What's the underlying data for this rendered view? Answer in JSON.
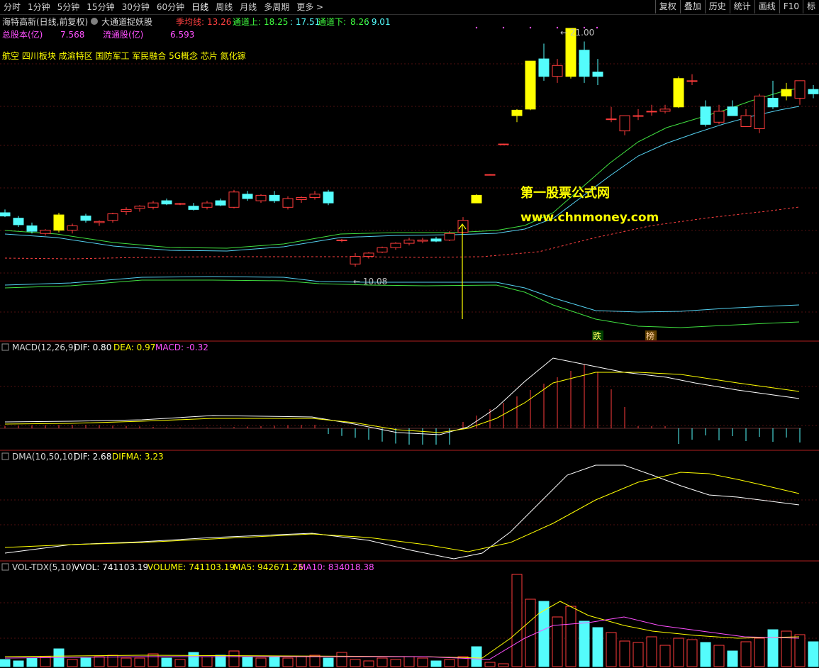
{
  "toolbar": {
    "tabs": [
      "分时",
      "1分钟",
      "5分钟",
      "15分钟",
      "30分钟",
      "60分钟",
      "日线",
      "周线",
      "月线",
      "多周期",
      "更多 >"
    ],
    "right_buttons": [
      "复权",
      "叠加",
      "历史",
      "统计",
      "画线",
      "F10",
      "标"
    ]
  },
  "main": {
    "stock_title": "海特高新(日线,前复权)",
    "indicator_name": "大通道捉妖股",
    "ma_label": "季均线:",
    "ma_value": "13.26",
    "up_label": "通道上:",
    "up_value": "18.25",
    "up_value2": "17.51",
    "down_label": "通道下:",
    "down_value": "8.26",
    "down_value2": "9.01",
    "total_shares_label": "总股本(亿)",
    "total_shares_value": "7.568",
    "float_shares_label": "流通股(亿)",
    "float_shares_value": "6.593",
    "concepts": "航空 四川板块 成渝特区 国防军工 军民融合 5G概念 芯片 氮化镓",
    "high_label": "← 21.00",
    "low_label": "← 10.08",
    "watermark_title": "第一股票公式网",
    "watermark_url": "www.chnmoney.com",
    "badge_die": "跌",
    "badge_bang": "榜"
  },
  "macd": {
    "title": "MACD(12,26,9)",
    "dif": "DIF: 0.80",
    "dea": "DEA: 0.97",
    "macd": "MACD: -0.32"
  },
  "dma": {
    "title": "DMA(10,50,10)",
    "dif": "DIF: 2.68",
    "difma": "DIFMA: 3.23"
  },
  "vol": {
    "title": "VOL-TDX(5,10)",
    "vvol": "VVOL: 741103.19",
    "volume": "VOLUME: 741103.19",
    "ma5": "MA5: 942671.25",
    "ma10": "MA10: 834018.38"
  },
  "colors": {
    "up": "#ff3c3c",
    "down": "#54fcfc",
    "signal": "#ffff00",
    "dash": "#ff4040"
  },
  "chart_data": {
    "type": "candlestick",
    "high": 21.0,
    "low": 10.08,
    "candles": [
      {
        "o": 12.55,
        "h": 12.7,
        "l": 12.35,
        "c": 12.4
      },
      {
        "o": 12.3,
        "h": 12.4,
        "l": 11.9,
        "c": 12.0
      },
      {
        "o": 11.95,
        "h": 12.1,
        "l": 11.6,
        "c": 11.7
      },
      {
        "o": 11.6,
        "h": 11.8,
        "l": 11.5,
        "c": 11.75
      },
      {
        "o": 12.45,
        "h": 12.55,
        "l": 11.65,
        "c": 11.75
      },
      {
        "o": 11.75,
        "h": 12.05,
        "l": 11.6,
        "c": 11.95
      },
      {
        "o": 12.4,
        "h": 12.5,
        "l": 12.1,
        "c": 12.2
      },
      {
        "o": 12.1,
        "h": 12.2,
        "l": 11.95,
        "c": 12.15
      },
      {
        "o": 12.2,
        "h": 12.55,
        "l": 12.1,
        "c": 12.5
      },
      {
        "o": 12.6,
        "h": 12.8,
        "l": 12.45,
        "c": 12.7
      },
      {
        "o": 12.75,
        "h": 12.9,
        "l": 12.6,
        "c": 12.85
      },
      {
        "o": 12.8,
        "h": 13.1,
        "l": 12.7,
        "c": 13.0
      },
      {
        "o": 13.1,
        "h": 13.2,
        "l": 12.9,
        "c": 12.95
      },
      {
        "o": 12.95,
        "h": 13.0,
        "l": 12.9,
        "c": 12.97
      },
      {
        "o": 12.85,
        "h": 13.0,
        "l": 12.65,
        "c": 12.7
      },
      {
        "o": 12.8,
        "h": 13.1,
        "l": 12.7,
        "c": 13.0
      },
      {
        "o": 13.1,
        "h": 13.2,
        "l": 12.85,
        "c": 12.9
      },
      {
        "o": 12.8,
        "h": 13.6,
        "l": 12.75,
        "c": 13.5
      },
      {
        "o": 13.4,
        "h": 13.55,
        "l": 13.1,
        "c": 13.2
      },
      {
        "o": 13.1,
        "h": 13.4,
        "l": 13.0,
        "c": 13.35
      },
      {
        "o": 13.35,
        "h": 13.55,
        "l": 13.0,
        "c": 13.1
      },
      {
        "o": 12.8,
        "h": 13.3,
        "l": 12.7,
        "c": 13.2
      },
      {
        "o": 13.15,
        "h": 13.3,
        "l": 13.0,
        "c": 13.25
      },
      {
        "o": 13.25,
        "h": 13.55,
        "l": 13.15,
        "c": 13.4
      },
      {
        "o": 13.5,
        "h": 13.6,
        "l": 12.9,
        "c": 13.0
      },
      {
        "o": 11.3,
        "h": 11.35,
        "l": 11.2,
        "c": 11.3
      },
      {
        "o": 10.2,
        "h": 10.7,
        "l": 10.08,
        "c": 10.55
      },
      {
        "o": 10.55,
        "h": 10.75,
        "l": 10.45,
        "c": 10.7
      },
      {
        "o": 10.75,
        "h": 11.0,
        "l": 10.7,
        "c": 10.95
      },
      {
        "o": 10.95,
        "h": 11.2,
        "l": 10.85,
        "c": 11.15
      },
      {
        "o": 11.15,
        "h": 11.4,
        "l": 11.05,
        "c": 11.3
      },
      {
        "o": 11.25,
        "h": 11.4,
        "l": 11.15,
        "c": 11.3
      },
      {
        "o": 11.35,
        "h": 11.45,
        "l": 11.2,
        "c": 11.25
      },
      {
        "o": 11.3,
        "h": 11.7,
        "l": 11.25,
        "c": 11.6
      },
      {
        "o": 11.65,
        "h": 12.35,
        "l": 11.6,
        "c": 12.2
      },
      {
        "o": 13.35,
        "h": 13.4,
        "l": 13.0,
        "c": 13.0
      },
      {
        "o": 14.3,
        "h": 14.32,
        "l": 14.28,
        "c": 14.3
      },
      {
        "o": 15.7,
        "h": 15.72,
        "l": 15.68,
        "c": 15.7
      },
      {
        "o": 17.0,
        "h": 17.3,
        "l": 16.7,
        "c": 17.25
      },
      {
        "o": 17.3,
        "h": 19.5,
        "l": 17.25,
        "c": 19.5
      },
      {
        "o": 19.6,
        "h": 20.3,
        "l": 18.6,
        "c": 18.8
      },
      {
        "o": 18.8,
        "h": 19.6,
        "l": 18.5,
        "c": 19.3
      },
      {
        "o": 18.8,
        "h": 21.0,
        "l": 18.7,
        "c": 21.0
      },
      {
        "o": 20.0,
        "h": 20.4,
        "l": 18.5,
        "c": 18.8
      },
      {
        "o": 19.0,
        "h": 19.6,
        "l": 18.4,
        "c": 18.8
      },
      {
        "o": 16.85,
        "h": 17.4,
        "l": 16.7,
        "c": 16.85
      },
      {
        "o": 16.3,
        "h": 17.0,
        "l": 16.1,
        "c": 17.0
      },
      {
        "o": 17.0,
        "h": 17.3,
        "l": 16.8,
        "c": 17.0
      },
      {
        "o": 17.2,
        "h": 17.5,
        "l": 17.0,
        "c": 17.2
      },
      {
        "o": 17.2,
        "h": 17.5,
        "l": 17.1,
        "c": 17.3
      },
      {
        "o": 17.4,
        "h": 18.8,
        "l": 17.35,
        "c": 18.7
      },
      {
        "o": 18.6,
        "h": 18.9,
        "l": 18.4,
        "c": 18.6
      },
      {
        "o": 17.4,
        "h": 17.7,
        "l": 16.5,
        "c": 16.6
      },
      {
        "o": 16.7,
        "h": 17.5,
        "l": 16.6,
        "c": 17.2
      },
      {
        "o": 17.4,
        "h": 17.7,
        "l": 17.0,
        "c": 17.0
      },
      {
        "o": 16.5,
        "h": 17.3,
        "l": 16.5,
        "c": 17.0
      },
      {
        "o": 16.4,
        "h": 18.0,
        "l": 16.2,
        "c": 17.9
      },
      {
        "o": 17.8,
        "h": 18.6,
        "l": 17.3,
        "c": 17.4
      },
      {
        "o": 17.9,
        "h": 18.5,
        "l": 17.7,
        "c": 18.2
      },
      {
        "o": 17.8,
        "h": 18.5,
        "l": 17.5,
        "c": 18.6
      },
      {
        "o": 18.2,
        "h": 18.4,
        "l": 17.8,
        "c": 18.0
      },
      {
        "o": 17.4,
        "h": 18.7,
        "l": 17.2,
        "c": 18.4
      },
      {
        "o": 18.4,
        "h": 18.5,
        "l": 17.6,
        "c": 17.9
      }
    ]
  }
}
